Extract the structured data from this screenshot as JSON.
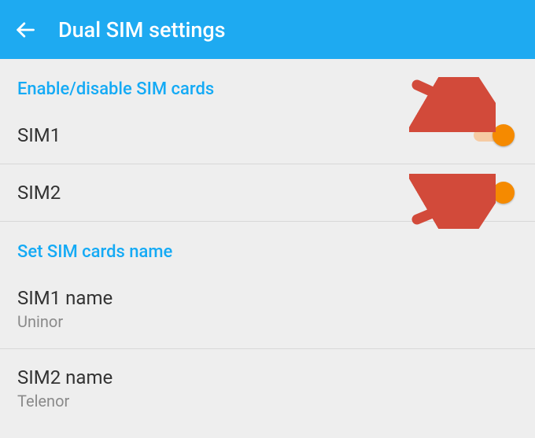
{
  "header": {
    "title": "Dual SIM settings"
  },
  "sections": {
    "enable": {
      "header": "Enable/disable SIM cards",
      "sim1": {
        "label": "SIM1",
        "on": true
      },
      "sim2": {
        "label": "SIM2",
        "on": true
      }
    },
    "names": {
      "header": "Set SIM cards name",
      "sim1": {
        "label": "SIM1 name",
        "value": "Uninor"
      },
      "sim2": {
        "label": "SIM2 name",
        "value": "Telenor"
      }
    }
  },
  "colors": {
    "headerBg": "#1eaaf1",
    "sectionAccent": "#14aaf5",
    "switchThumb": "#f58a00",
    "switchTrack": "#f6cba3",
    "arrow": "#d24a3a"
  }
}
